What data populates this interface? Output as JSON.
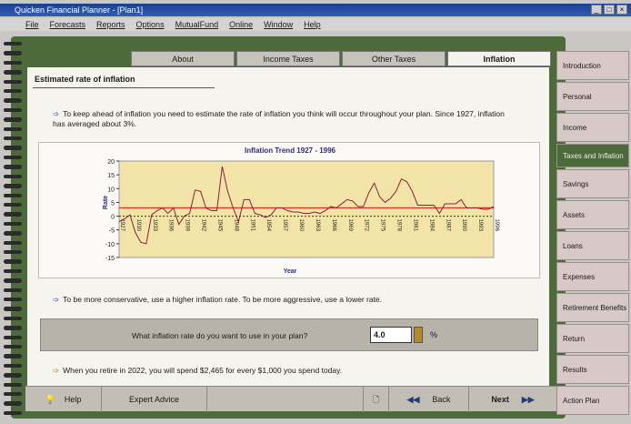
{
  "window": {
    "title": "Quicken Financial Planner - [Plan1]"
  },
  "menu": [
    "File",
    "Forecasts",
    "Reports",
    "Options",
    "MutualFund",
    "Online",
    "Window",
    "Help"
  ],
  "tabs": [
    "About",
    "Income Taxes",
    "Other Taxes",
    "Inflation"
  ],
  "section_title": "Estimated rate of inflation",
  "intro_text": "To keep ahead of inflation you need to estimate the rate of inflation you think will occur throughout your plan. Since 1927, inflation has averaged about 3%.",
  "advice_text": "To be more conservative, use a higher inflation rate. To be more aggressive, use a lower rate.",
  "question": {
    "label": "What inflation rate do you want to use in your plan?",
    "value": "4.0",
    "unit": "%"
  },
  "retire_text": "When you retire in 2022, you will spend $2,465 for every $1,000 you spend today.",
  "bottom_bar": {
    "help": "Help",
    "expert": "Expert Advice",
    "back": "Back",
    "next": "Next"
  },
  "right_nav": [
    "Introduction",
    "Personal",
    "Income",
    "Taxes and Inflation",
    "Savings",
    "Assets",
    "Loans",
    "Expenses",
    "Retirement Benefits",
    "Return",
    "Results",
    "Action Plan"
  ],
  "colors": {
    "frame": "#4d6b3a",
    "nav": "#d9c8c8",
    "plot_bg": "#f2e4a6",
    "line": "#8a1f3a",
    "avg_line": "#d9311f"
  },
  "chart_data": {
    "type": "line",
    "title": "Inflation Trend 1927 - 1996",
    "xlabel": "Year",
    "ylabel": "Rate",
    "ylim": [
      -15,
      20
    ],
    "yticks": [
      20,
      15,
      10,
      5,
      0,
      -5,
      -10,
      -15
    ],
    "xticks": [
      "1927",
      "1930",
      "1933",
      "1936",
      "1939",
      "1942",
      "1945",
      "1948",
      "1951",
      "1954",
      "1957",
      "1960",
      "1963",
      "1966",
      "1969",
      "1972",
      "1975",
      "1978",
      "1981",
      "1984",
      "1987",
      "1990",
      "1993",
      "1996"
    ],
    "average": 3,
    "series": [
      {
        "x": [
          1927,
          1928,
          1929,
          1930,
          1931,
          1932,
          1933,
          1934,
          1935,
          1936,
          1937,
          1938,
          1939,
          1940,
          1941,
          1942,
          1943,
          1944,
          1945,
          1946,
          1947,
          1948,
          1949,
          1950,
          1951,
          1952,
          1953,
          1954,
          1955,
          1956,
          1957,
          1958,
          1959,
          1960,
          1961,
          1962,
          1963,
          1964,
          1965,
          1966,
          1967,
          1968,
          1969,
          1970,
          1971,
          1972,
          1973,
          1974,
          1975,
          1976,
          1977,
          1978,
          1979,
          1980,
          1981,
          1982,
          1983,
          1984,
          1985,
          1986,
          1987,
          1988,
          1989,
          1990,
          1991,
          1992,
          1993,
          1994,
          1995,
          1996
        ],
        "values": [
          -2,
          -1,
          0.5,
          -6,
          -9.5,
          -10,
          0.5,
          2,
          3,
          1,
          3,
          -3,
          0,
          1,
          9.5,
          9,
          3,
          2,
          2,
          18,
          9,
          3,
          -2,
          6,
          6,
          1,
          0.5,
          -0.5,
          0.5,
          3,
          3,
          2,
          1.5,
          1.5,
          1,
          1,
          1.5,
          1,
          2,
          3.5,
          3,
          4.5,
          6,
          5.5,
          3.5,
          3.5,
          8.5,
          12,
          7,
          5,
          6.5,
          9,
          13.5,
          12.5,
          9,
          4,
          4,
          4,
          4,
          1,
          4.5,
          4.5,
          4.5,
          6,
          3,
          3,
          3,
          2.5,
          2.5,
          3.5
        ]
      }
    ]
  }
}
